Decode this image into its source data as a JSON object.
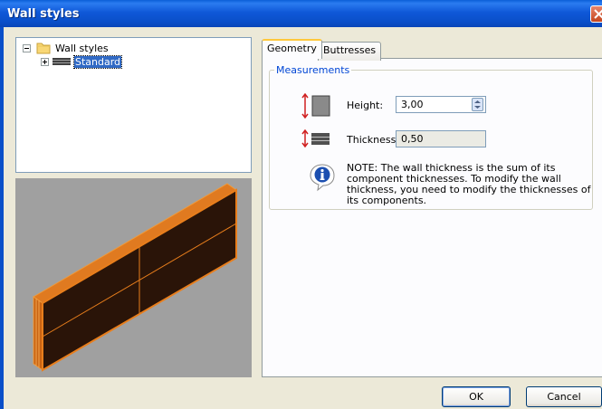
{
  "window": {
    "title": "Wall styles"
  },
  "tree": {
    "root": {
      "label": "Wall styles",
      "expanded": true,
      "icon": "folder-icon"
    },
    "children": [
      {
        "label": "Standard",
        "selected": true,
        "icon": "wall-layers-icon",
        "expanded": false
      }
    ]
  },
  "tabs": [
    {
      "label": "Geometry",
      "active": true
    },
    {
      "label": "Buttresses",
      "active": false
    }
  ],
  "measurements": {
    "group_label": "Measurements",
    "height_label": "Height:",
    "height_value": "3,00",
    "thickness_label": "Thickness",
    "thickness_value": "0,50",
    "note": "NOTE: The wall thickness is the sum of its component thicknesses. To modify the wall thickness, you need to modify the thicknesses of its components."
  },
  "buttons": {
    "ok": "OK",
    "cancel": "Cancel"
  },
  "colors": {
    "titlebar": "#0a4fc9",
    "wall_edge": "#e87e1c",
    "wall_face": "#2a1408",
    "preview_bg": "#a0a0a0",
    "group_label": "#0046d5",
    "height_icon_arrow": "#d02020"
  }
}
